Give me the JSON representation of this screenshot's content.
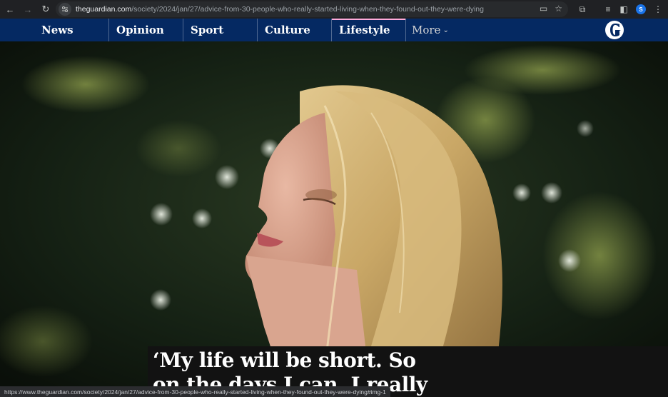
{
  "browser": {
    "url_host": "theguardian.com",
    "url_path": "/society/2024/jan/27/advice-from-30-people-who-really-started-living-when-they-found-out-they-were-dying",
    "profile_initial": "S",
    "status_url": "https://www.theguardian.com/society/2024/jan/27/advice-from-30-people-who-really-started-living-when-they-found-out-they-were-dying#img-1"
  },
  "nav": {
    "pillars": [
      {
        "label": "News"
      },
      {
        "label": "Opinion"
      },
      {
        "label": "Sport"
      },
      {
        "label": "Culture"
      },
      {
        "label": "Lifestyle"
      }
    ],
    "more_label": "More",
    "active_color": "#ffabdb",
    "background": "#052962"
  },
  "article": {
    "headline_line1": "‘My life will be short. So",
    "headline_line2": "on the days I can, I really"
  }
}
